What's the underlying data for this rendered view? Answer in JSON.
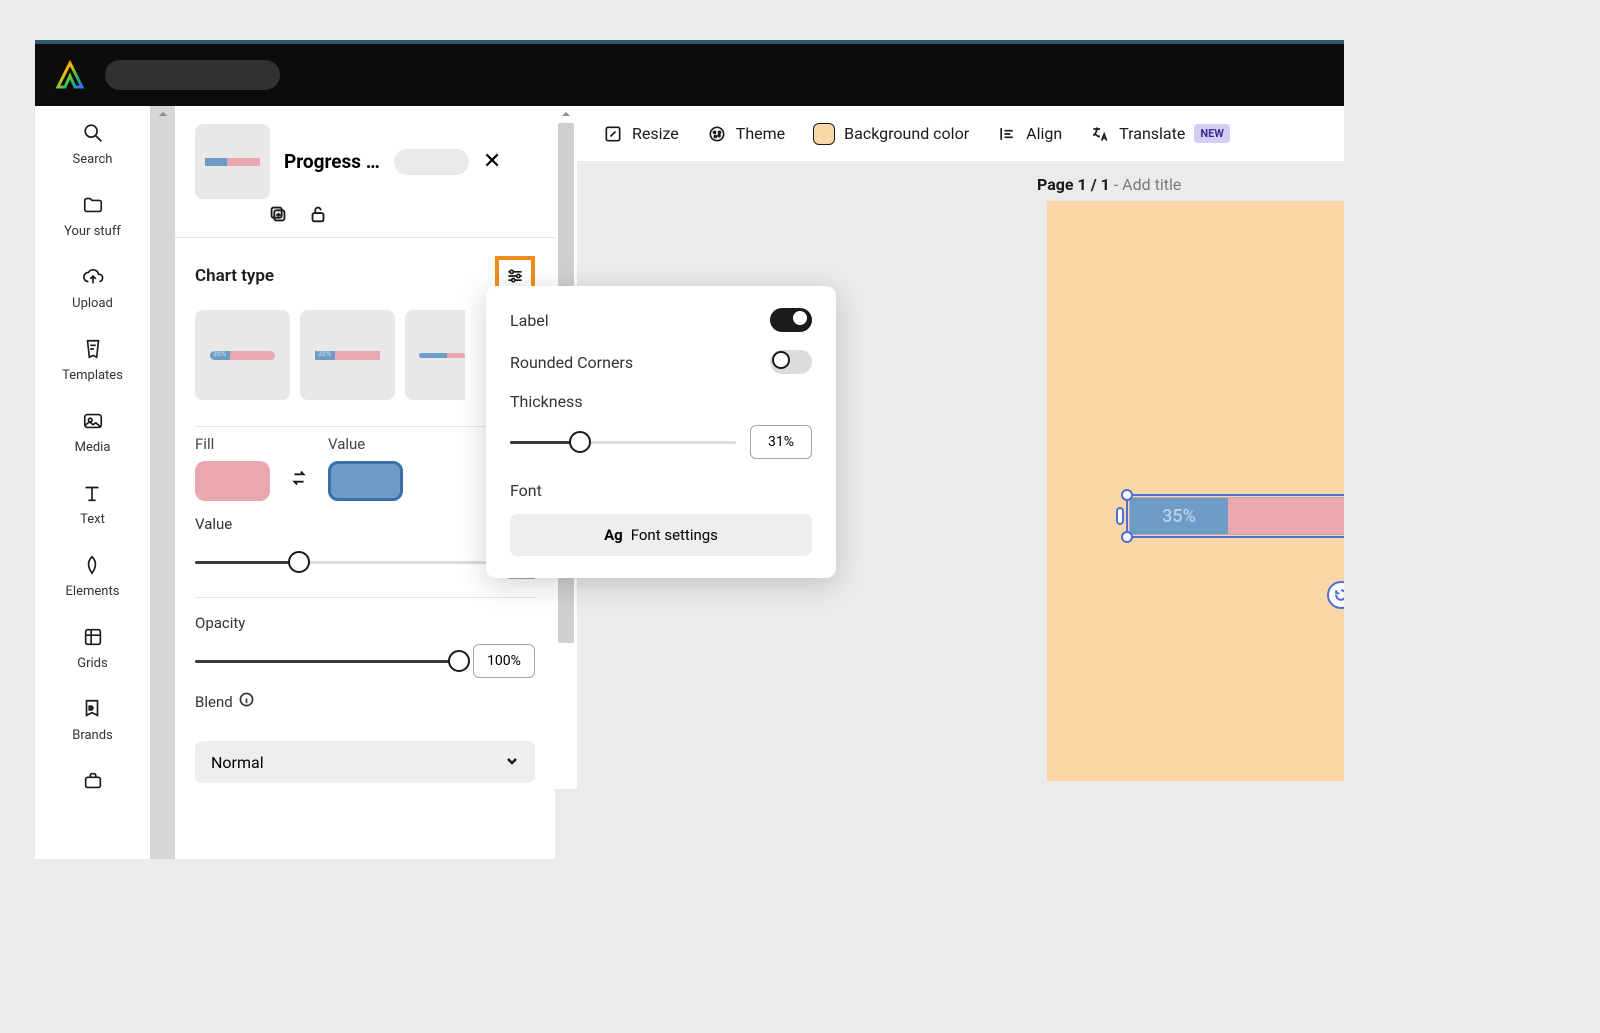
{
  "nav": {
    "items": [
      {
        "label": "Search"
      },
      {
        "label": "Your stuff"
      },
      {
        "label": "Upload"
      },
      {
        "label": "Templates"
      },
      {
        "label": "Media"
      },
      {
        "label": "Text"
      },
      {
        "label": "Elements"
      },
      {
        "label": "Grids"
      },
      {
        "label": "Brands"
      }
    ]
  },
  "props": {
    "title": "Progress …",
    "fill_label": "Fill",
    "value_label": "Value",
    "value_slider_label": "Value",
    "value_slider_percent": 35,
    "opacity_label": "Opacity",
    "opacity_value": "100%",
    "opacity_percent": 100,
    "blend_label": "Blend",
    "blend_value": "Normal",
    "chart_type_label": "Chart type"
  },
  "popover": {
    "label_txt": "Label",
    "label_on": true,
    "rounded_txt": "Rounded Corners",
    "rounded_on": false,
    "thickness_txt": "Thickness",
    "thickness_val": "31%",
    "thickness_pct": 31,
    "font_txt": "Font",
    "font_btn": "Font settings",
    "font_prefix": "Ag"
  },
  "toolbar": {
    "resize": "Resize",
    "theme": "Theme",
    "bg": "Background color",
    "align": "Align",
    "translate": "Translate",
    "new_badge": "NEW"
  },
  "canvas": {
    "page_label": "Page 1 / 1",
    "page_suffix": " - Add title",
    "progress_value": "35%"
  },
  "colors": {
    "fill": "#e9a8b0",
    "value": "#6e9cc7",
    "artboard": "#fbd6a6",
    "highlight": "#f08c1e"
  }
}
